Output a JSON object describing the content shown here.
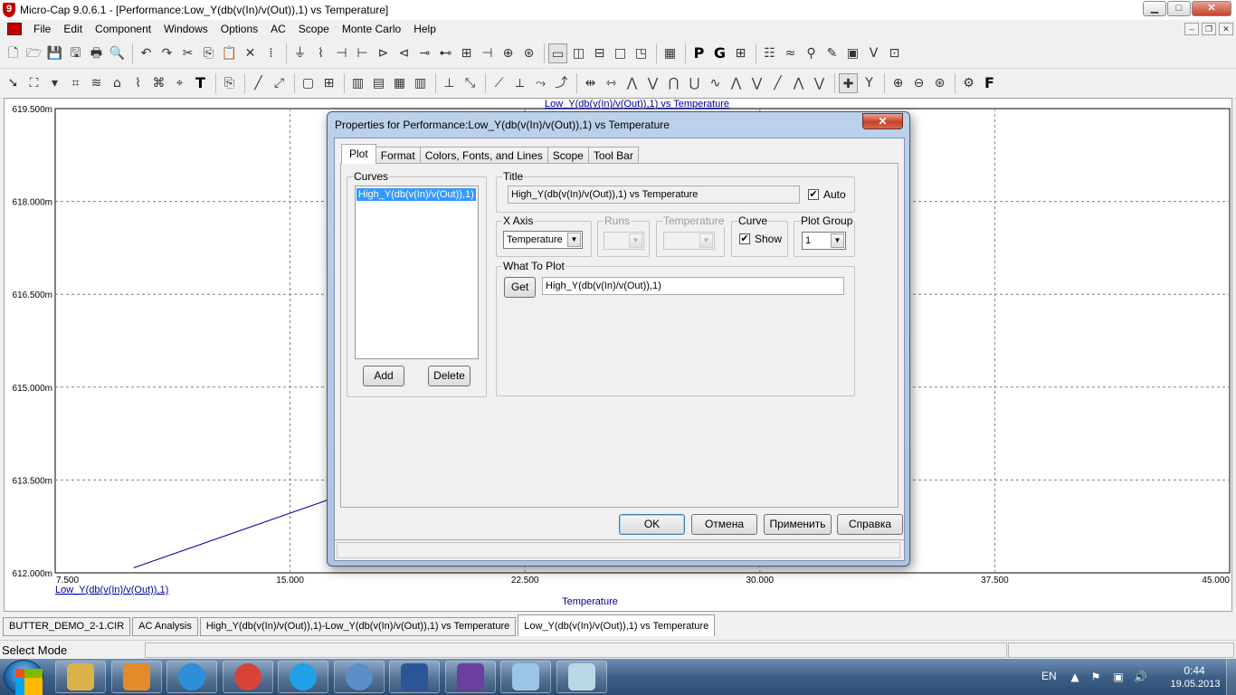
{
  "window": {
    "title": "Micro-Cap 9.0.6.1 - [Performance:Low_Y(db(v(In)/v(Out)),1) vs Temperature]",
    "controls": {
      "minimize": "▁",
      "maximize": "□",
      "close": "✕"
    }
  },
  "menu": [
    "File",
    "Edit",
    "Component",
    "Windows",
    "Options",
    "AC",
    "Scope",
    "Monte Carlo",
    "Help"
  ],
  "mdi_controls": {
    "minimize": "–",
    "restore": "❐",
    "close": "✕"
  },
  "toolbar1": {
    "icons": [
      "new-file-icon",
      "open-file-icon",
      "save-icon",
      "save-all-icon",
      "print-icon",
      "print-preview-icon",
      "undo-icon",
      "redo-icon",
      "cut-icon",
      "copy-icon",
      "paste-icon",
      "delete-icon",
      "select-all-icon"
    ],
    "glyphs": [
      "🗋",
      "🗁",
      "💾",
      "🖫",
      "🖶",
      "🔍",
      "↶",
      "↷",
      "✂",
      "⎘",
      "📋",
      "✕",
      "⁞"
    ],
    "component_glyphs": [
      "⏚",
      "⌇",
      "⊣",
      "⊢",
      "⊳",
      "⊲",
      "⊸",
      "⊷",
      "⊞",
      "⊣",
      "⊕",
      "⊛"
    ],
    "letters": {
      "p": "P",
      "g": "G"
    }
  },
  "toolbar2": {
    "glyphs": [
      "➚",
      "⛶",
      "⌗",
      "≋",
      "⌂",
      "⌇",
      "⌘",
      "⌖"
    ],
    "text_tool": "T",
    "zoom_glyphs": [
      "⊕",
      "⊖",
      "⊛"
    ],
    "font_tool": "F"
  },
  "plot": {
    "title": "Low_Y(db(v(In)/v(Out)),1) vs Temperature",
    "legend_label": "Low_Y(db(v(In)/v(Out)),1)",
    "xlabel": "Temperature",
    "line_color": "#0000a0",
    "grid_color": "#808080"
  },
  "chart_data": {
    "type": "line",
    "title": "Low_Y(db(v(In)/v(Out)),1) vs Temperature",
    "xlabel": "Temperature",
    "ylabel": "",
    "x_ticks": [
      "7.500",
      "15.000",
      "22.500",
      "30.000",
      "37.500",
      "45.000"
    ],
    "y_ticks": [
      "619.500m",
      "618.000m",
      "616.500m",
      "615.000m",
      "613.500m",
      "612.000m"
    ],
    "xlim": [
      7.5,
      45.0
    ],
    "ylim": [
      0.612,
      0.6195
    ],
    "grid": true,
    "series": [
      {
        "name": "Low_Y(db(v(In)/v(Out)),1)",
        "color": "#0000a0",
        "x": [
          10.0,
          17.8
        ],
        "y": [
          0.61208,
          0.61346
        ]
      }
    ]
  },
  "doc_tabs": [
    "BUTTER_DEMO_2-1.CIR",
    "AC Analysis",
    "High_Y(db(v(In)/v(Out)),1)-Low_Y(db(v(In)/v(Out)),1) vs Temperature",
    "Low_Y(db(v(In)/v(Out)),1) vs Temperature"
  ],
  "status": {
    "mode": "Select Mode"
  },
  "dialog": {
    "title": "Properties for Performance:Low_Y(db(v(In)/v(Out)),1) vs Temperature",
    "close": "✕",
    "tabs": [
      "Plot",
      "Format",
      "Colors, Fonts, and Lines",
      "Scope",
      "Tool Bar"
    ],
    "curves": {
      "legend": "Curves",
      "items": [
        "High_Y(db(v(In)/v(Out)),1)"
      ],
      "add": "Add",
      "delete": "Delete"
    },
    "title_group": {
      "legend": "Title",
      "value": "High_Y(db(v(In)/v(Out)),1) vs Temperature",
      "auto_label": "Auto",
      "auto_checked": true
    },
    "x_axis": {
      "legend": "X Axis",
      "value": "Temperature"
    },
    "runs": {
      "legend": "Runs",
      "value": ""
    },
    "temperature": {
      "legend": "Temperature",
      "value": ""
    },
    "curve": {
      "legend": "Curve",
      "show_label": "Show",
      "show_checked": true
    },
    "plot_group": {
      "legend": "Plot Group",
      "value": "1"
    },
    "what_to_plot": {
      "legend": "What To Plot",
      "get": "Get",
      "value": "High_Y(db(v(In)/v(Out)),1)"
    },
    "buttons": {
      "ok": "OK",
      "cancel": "Отмена",
      "apply": "Применить",
      "help": "Справка"
    }
  },
  "taskbar": {
    "apps": [
      "file-manager-icon",
      "media-player-icon",
      "internet-explorer-icon",
      "chrome-icon",
      "skype-icon",
      "app-icon",
      "word-icon",
      "draw-icon",
      "paint-icon",
      "notepad-icon"
    ],
    "app_colors": [
      "#d9b34a",
      "#e58a2b",
      "#2e8fd8",
      "#d9443a",
      "#1ea1e6",
      "#5b8ec8",
      "#2a5699",
      "#6a3fa0",
      "#9cc4e4",
      "#b8d8e8"
    ],
    "language": "EN",
    "tray_glyphs": [
      "▲",
      "⚑",
      "▣",
      "🔊"
    ],
    "time": "0:44",
    "date": "19.05.2013"
  }
}
